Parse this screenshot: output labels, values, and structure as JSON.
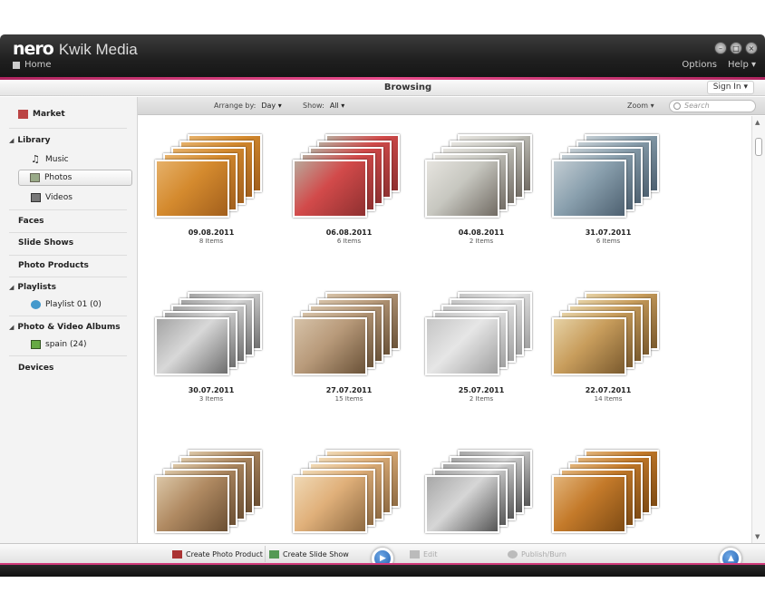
{
  "app": {
    "brand": "nero",
    "product": "Kwik Media",
    "home": "Home",
    "options": "Options",
    "help": "Help ▾"
  },
  "window": {
    "min": "–",
    "max": "□",
    "close": "×"
  },
  "tabbar": {
    "title": "Browsing",
    "signin": "Sign In ▾"
  },
  "sidebar": {
    "market": "Market",
    "library": "Library",
    "music": "Music",
    "photos": "Photos",
    "videos": "Videos",
    "faces": "Faces",
    "slideshows": "Slide Shows",
    "photoproducts": "Photo Products",
    "playlists": "Playlists",
    "playlist01": "Playlist 01 (0)",
    "albums": "Photo & Video Albums",
    "spain": "spain (24)",
    "devices": "Devices"
  },
  "toolbar": {
    "arrange_label": "Arrange by:",
    "arrange_value": "Day ▾",
    "show_label": "Show:",
    "show_value": "All ▾",
    "zoom": "Zoom ▾",
    "search_placeholder": "Search"
  },
  "albums": [
    {
      "date": "09.08.2011",
      "count": "8 Items",
      "colors": [
        "#d48a2e",
        "#a25f1c",
        "#e6b16a"
      ]
    },
    {
      "date": "06.08.2011",
      "count": "6 Items",
      "colors": [
        "#d24a4a",
        "#8e3030",
        "#b9a79a"
      ]
    },
    {
      "date": "04.08.2011",
      "count": "2 Items",
      "colors": [
        "#c7c7c0",
        "#716b63",
        "#e6e4df"
      ]
    },
    {
      "date": "31.07.2011",
      "count": "6 Items",
      "colors": [
        "#8aa0ae",
        "#4d6070",
        "#c3cdd3"
      ]
    },
    {
      "date": "30.07.2011",
      "count": "3 Items",
      "colors": [
        "#d8d8d8",
        "#6e6e6e",
        "#a4a4a4"
      ]
    },
    {
      "date": "27.07.2011",
      "count": "15 Items",
      "colors": [
        "#b89a7a",
        "#6a5238",
        "#d6c2a8"
      ]
    },
    {
      "date": "25.07.2011",
      "count": "2 Items",
      "colors": [
        "#e6e6e6",
        "#9f9f9f",
        "#c5c5c5"
      ]
    },
    {
      "date": "22.07.2011",
      "count": "14 Items",
      "colors": [
        "#c89d5c",
        "#7a5a2e",
        "#e6d2a6"
      ]
    },
    {
      "date": "",
      "count": "",
      "colors": [
        "#b08a62",
        "#6b4f33",
        "#dcc7a7"
      ]
    },
    {
      "date": "",
      "count": "",
      "colors": [
        "#e0b07a",
        "#8e6a42",
        "#f0d9b5"
      ]
    },
    {
      "date": "",
      "count": "",
      "colors": [
        "#d6d6d6",
        "#555",
        "#a7a7a7"
      ]
    },
    {
      "date": "",
      "count": "",
      "colors": [
        "#c47a2a",
        "#7e4b14",
        "#e2b47a"
      ]
    }
  ],
  "bottombar": {
    "create_photo": "Create Photo Product",
    "create_slide": "Create Slide Show",
    "edit": "Edit",
    "publish": "Publish/Burn"
  }
}
